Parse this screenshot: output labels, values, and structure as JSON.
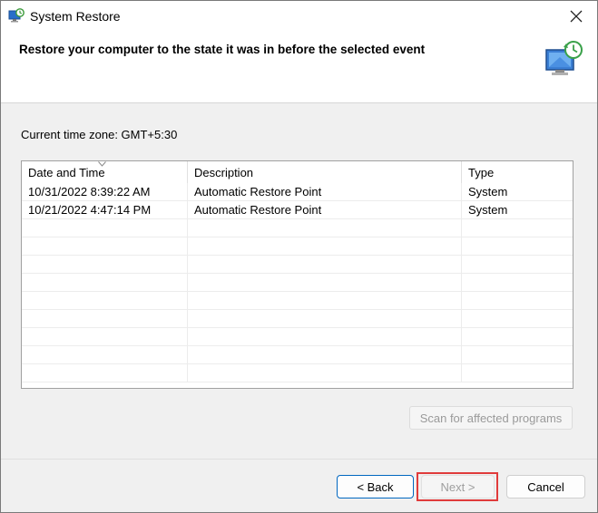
{
  "window": {
    "title": "System Restore",
    "app_icon": "system-restore-icon",
    "close_icon": "close-icon"
  },
  "header": {
    "heading": "Restore your computer to the state it was in before the selected event",
    "icon": "system-restore-monitor-icon"
  },
  "timezone": {
    "label": "Current time zone: GMT+5:30"
  },
  "table": {
    "columns": [
      "Date and Time",
      "Description",
      "Type"
    ],
    "sorted_column": "Date and Time",
    "rows": [
      {
        "date": "10/31/2022 8:39:22 AM",
        "description": "Automatic Restore Point",
        "type": "System"
      },
      {
        "date": "10/21/2022 4:47:14 PM",
        "description": "Automatic Restore Point",
        "type": "System"
      }
    ]
  },
  "buttons": {
    "scan": "Scan for affected programs",
    "back": "< Back",
    "next": "Next >",
    "cancel": "Cancel"
  },
  "colors": {
    "accent": "#0067c0",
    "highlight": "#e03b3b"
  }
}
